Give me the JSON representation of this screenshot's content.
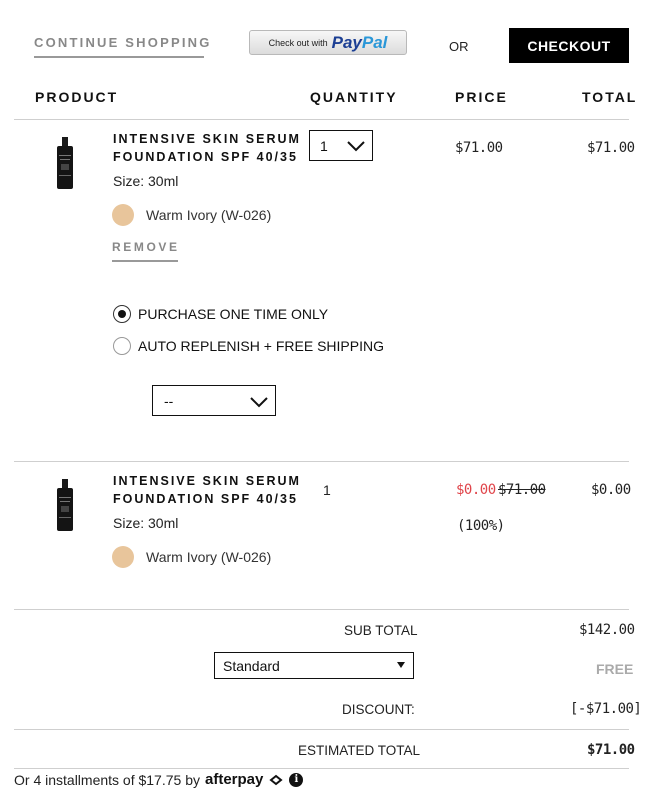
{
  "top": {
    "continue_label": "CONTINUE SHOPPING",
    "paypal_prefix": "Check out with",
    "paypal_brand_a": "Pay",
    "paypal_brand_b": "Pal",
    "or_label": "OR",
    "checkout_label": "CHECKOUT"
  },
  "headers": {
    "product": "PRODUCT",
    "quantity": "QUANTITY",
    "price": "PRICE",
    "total": "TOTAL"
  },
  "items": [
    {
      "name_line1": "INTENSIVE SKIN SERUM",
      "name_line2": "FOUNDATION SPF 40/35",
      "size": "Size: 30ml",
      "shade": "Warm Ivory (W-026)",
      "shade_color": "#e8c59b",
      "quantity": "1",
      "price": "$71.00",
      "total": "$71.00",
      "remove_label": "REMOVE",
      "purchase_options": [
        {
          "label": "PURCHASE ONE TIME ONLY",
          "selected": true
        },
        {
          "label": "AUTO REPLENISH + FREE SHIPPING",
          "selected": false
        }
      ],
      "frequency_value": "--"
    },
    {
      "name_line1": "INTENSIVE SKIN SERUM",
      "name_line2": "FOUNDATION SPF 40/35",
      "size": "Size: 30ml",
      "shade": "Warm Ivory (W-026)",
      "shade_color": "#e8c59b",
      "quantity": "1",
      "sale_price": "$0.00",
      "original_price": "$71.00",
      "discount_pct": "(100%)",
      "total": "$0.00"
    }
  ],
  "summary": {
    "subtotal_label": "SUB TOTAL",
    "subtotal_value": "$142.00",
    "shipping_method": "Standard",
    "shipping_value": "FREE",
    "discount_label": "DISCOUNT:",
    "discount_value": "[-$71.00]",
    "estimated_label": "ESTIMATED TOTAL",
    "estimated_value": "$71.00"
  },
  "afterpay": {
    "text": "Or 4 installments of $17.75 by",
    "brand": "afterpay",
    "info_icon": "i"
  },
  "colors": {
    "accent": "#000000",
    "sale_red": "#e0444a",
    "swatch": "#e8c59b"
  }
}
